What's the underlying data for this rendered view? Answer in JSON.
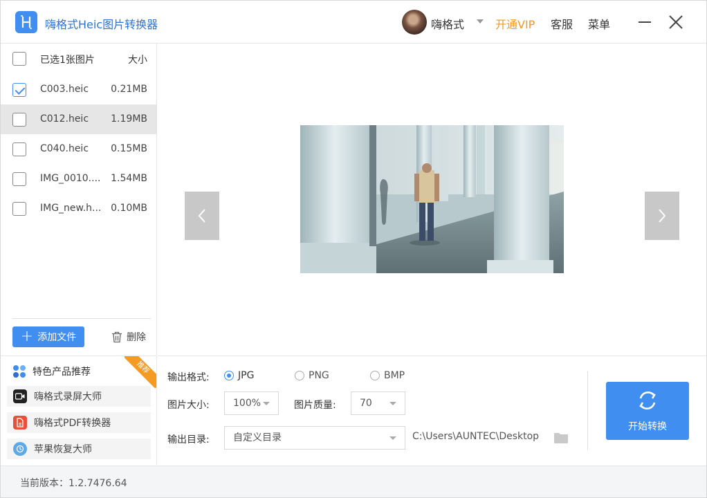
{
  "app": {
    "title": "嗨格式Heic图片转换器",
    "brand_color": "#3f8ef0"
  },
  "header": {
    "username": "嗨格式",
    "vip_label": "开通VIP",
    "service_label": "客服",
    "menu_label": "菜单",
    "vip_color": "#f09a1d"
  },
  "file_list": {
    "header_label": "已选1张图片",
    "size_header": "大小",
    "items": [
      {
        "name": "C003.heic",
        "size": "0.21MB",
        "checked": true
      },
      {
        "name": "C012.heic",
        "size": "1.19MB",
        "checked": false
      },
      {
        "name": "C040.heic",
        "size": "0.15MB",
        "checked": false
      },
      {
        "name": "IMG_0010....",
        "size": "1.54MB",
        "checked": false
      },
      {
        "name": "IMG_new.h...",
        "size": "0.10MB",
        "checked": false
      }
    ],
    "add_label": "添加文件",
    "delete_label": "删除"
  },
  "recommend": {
    "title": "特色产品推荐",
    "badge": "推荐",
    "items": [
      {
        "label": "嗨格式录屏大师",
        "icon": "screen-recorder-icon"
      },
      {
        "label": "嗨格式PDF转换器",
        "icon": "pdf-converter-icon"
      },
      {
        "label": "苹果恢复大师",
        "icon": "apple-recovery-icon"
      }
    ]
  },
  "settings": {
    "format_label": "输出格式:",
    "formats": [
      "JPG",
      "PNG",
      "BMP"
    ],
    "selected_format": "JPG",
    "size_label": "图片大小:",
    "size_value": "100%",
    "quality_label": "图片质量:",
    "quality_value": "70",
    "dir_label": "输出目录:",
    "dir_value": "自定义目录",
    "dir_path": "C:\\Users\\AUNTEC\\Desktop",
    "convert_label": "开始转换"
  },
  "footer": {
    "version": "当前版本：1.2.7476.64"
  }
}
